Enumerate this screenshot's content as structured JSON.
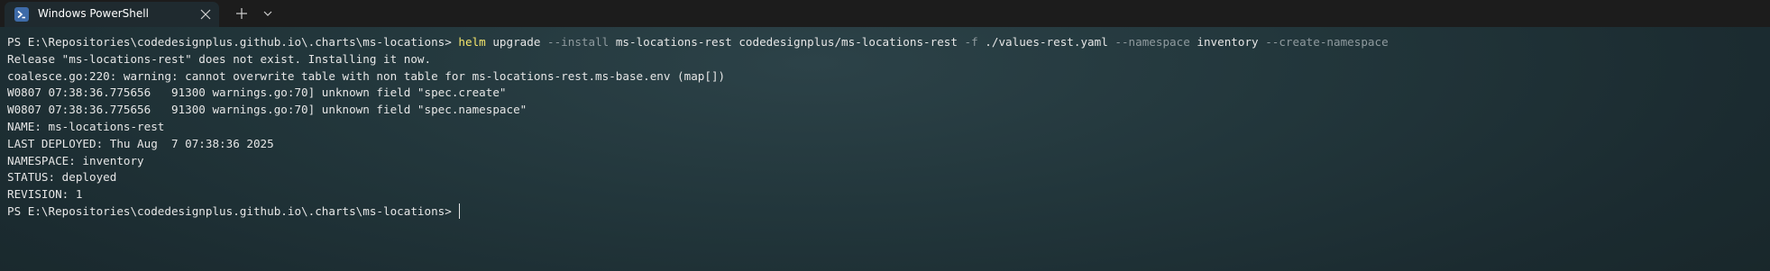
{
  "tab": {
    "title": "Windows PowerShell",
    "icon": "powershell-icon"
  },
  "titlebar": {
    "new_tab_icon": "plus-icon",
    "dropdown_icon": "chevron-down-icon",
    "close_icon": "close-icon"
  },
  "colors": {
    "command": "#f5e56b",
    "parameter": "#8f9a9e",
    "text": "#e6e6e6"
  },
  "terminal": {
    "command_line": {
      "prompt": "PS E:\\Repositories\\codedesignplus.github.io\\.charts\\ms-locations> ",
      "command": "helm",
      "arg1": " upgrade ",
      "param_install": "--install",
      "arg2": " ms-locations-rest codedesignplus/ms-locations-rest ",
      "param_f": "-f",
      "arg3": " ./values-rest.yaml ",
      "param_namespace": "--namespace",
      "arg4": " inventory ",
      "param_create_namespace": "--create-namespace"
    },
    "output": [
      "Release \"ms-locations-rest\" does not exist. Installing it now.",
      "coalesce.go:220: warning: cannot overwrite table with non table for ms-locations-rest.ms-base.env (map[])",
      "W0807 07:38:36.775656   91300 warnings.go:70] unknown field \"spec.create\"",
      "W0807 07:38:36.775656   91300 warnings.go:70] unknown field \"spec.namespace\"",
      "NAME: ms-locations-rest",
      "LAST DEPLOYED: Thu Aug  7 07:38:36 2025",
      "NAMESPACE: inventory",
      "STATUS: deployed",
      "REVISION: 1"
    ],
    "final_prompt": "PS E:\\Repositories\\codedesignplus.github.io\\.charts\\ms-locations> "
  }
}
